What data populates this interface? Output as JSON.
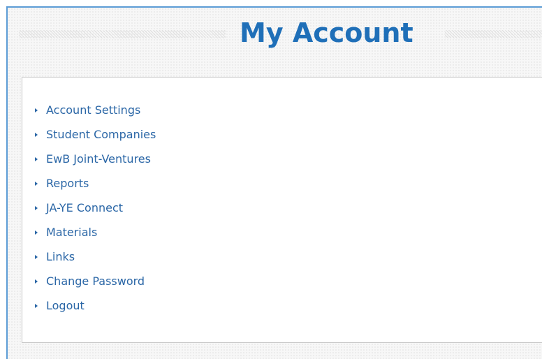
{
  "header": {
    "title": "My Account"
  },
  "menu": {
    "items": [
      {
        "label": "Account Settings"
      },
      {
        "label": "Student Companies"
      },
      {
        "label": "EwB Joint-Ventures"
      },
      {
        "label": "Reports"
      },
      {
        "label": "JA-YE Connect"
      },
      {
        "label": "Materials"
      },
      {
        "label": "Links"
      },
      {
        "label": "Change Password"
      },
      {
        "label": "Logout"
      }
    ]
  },
  "colors": {
    "title": "#1f6fb8",
    "link": "#2a66a6",
    "frame_border": "#5b9bd5",
    "panel_border": "#c9c9c9"
  },
  "icons": {
    "menu_bullet": "triangle-right-icon"
  }
}
